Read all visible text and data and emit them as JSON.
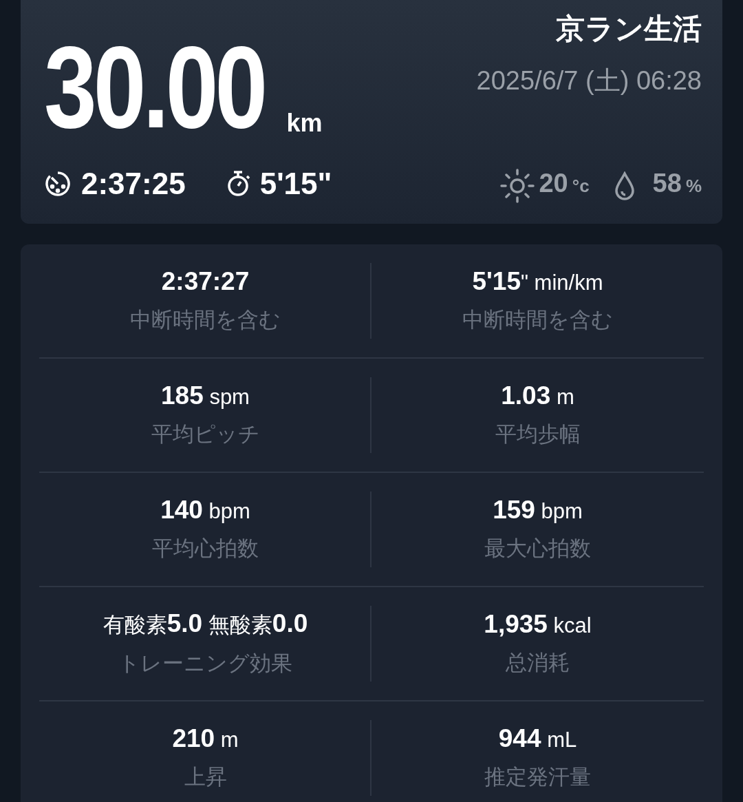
{
  "header": {
    "title": "京ラン生活",
    "datetime": "2025/6/7 (土) 06:28",
    "distance": "30.00",
    "distance_unit": "km",
    "duration": "2:37:25",
    "pace": "5'15\"",
    "temperature": "20",
    "temperature_unit": "°c",
    "humidity": "58",
    "humidity_unit": "%"
  },
  "stats": [
    {
      "value": "**2:37:27**",
      "label": "中断時間を含む"
    },
    {
      "value": "**5'15**\" min/km",
      "label": "中断時間を含む"
    },
    {
      "value": "**185** spm",
      "label": "平均ピッチ"
    },
    {
      "value": "**1.03** m",
      "label": "平均歩幅"
    },
    {
      "value": "**140** bpm",
      "label": "平均心拍数"
    },
    {
      "value": "**159** bpm",
      "label": "最大心拍数"
    },
    {
      "value": "有酸素**5.0** 無酸素**0.0**",
      "label": "トレーニング効果"
    },
    {
      "value": "**1,935** kcal",
      "label": "总消耗"
    },
    {
      "value": "**210** m",
      "label": "上昇"
    },
    {
      "value": "**944** mL",
      "label": "推定発汗量"
    }
  ]
}
